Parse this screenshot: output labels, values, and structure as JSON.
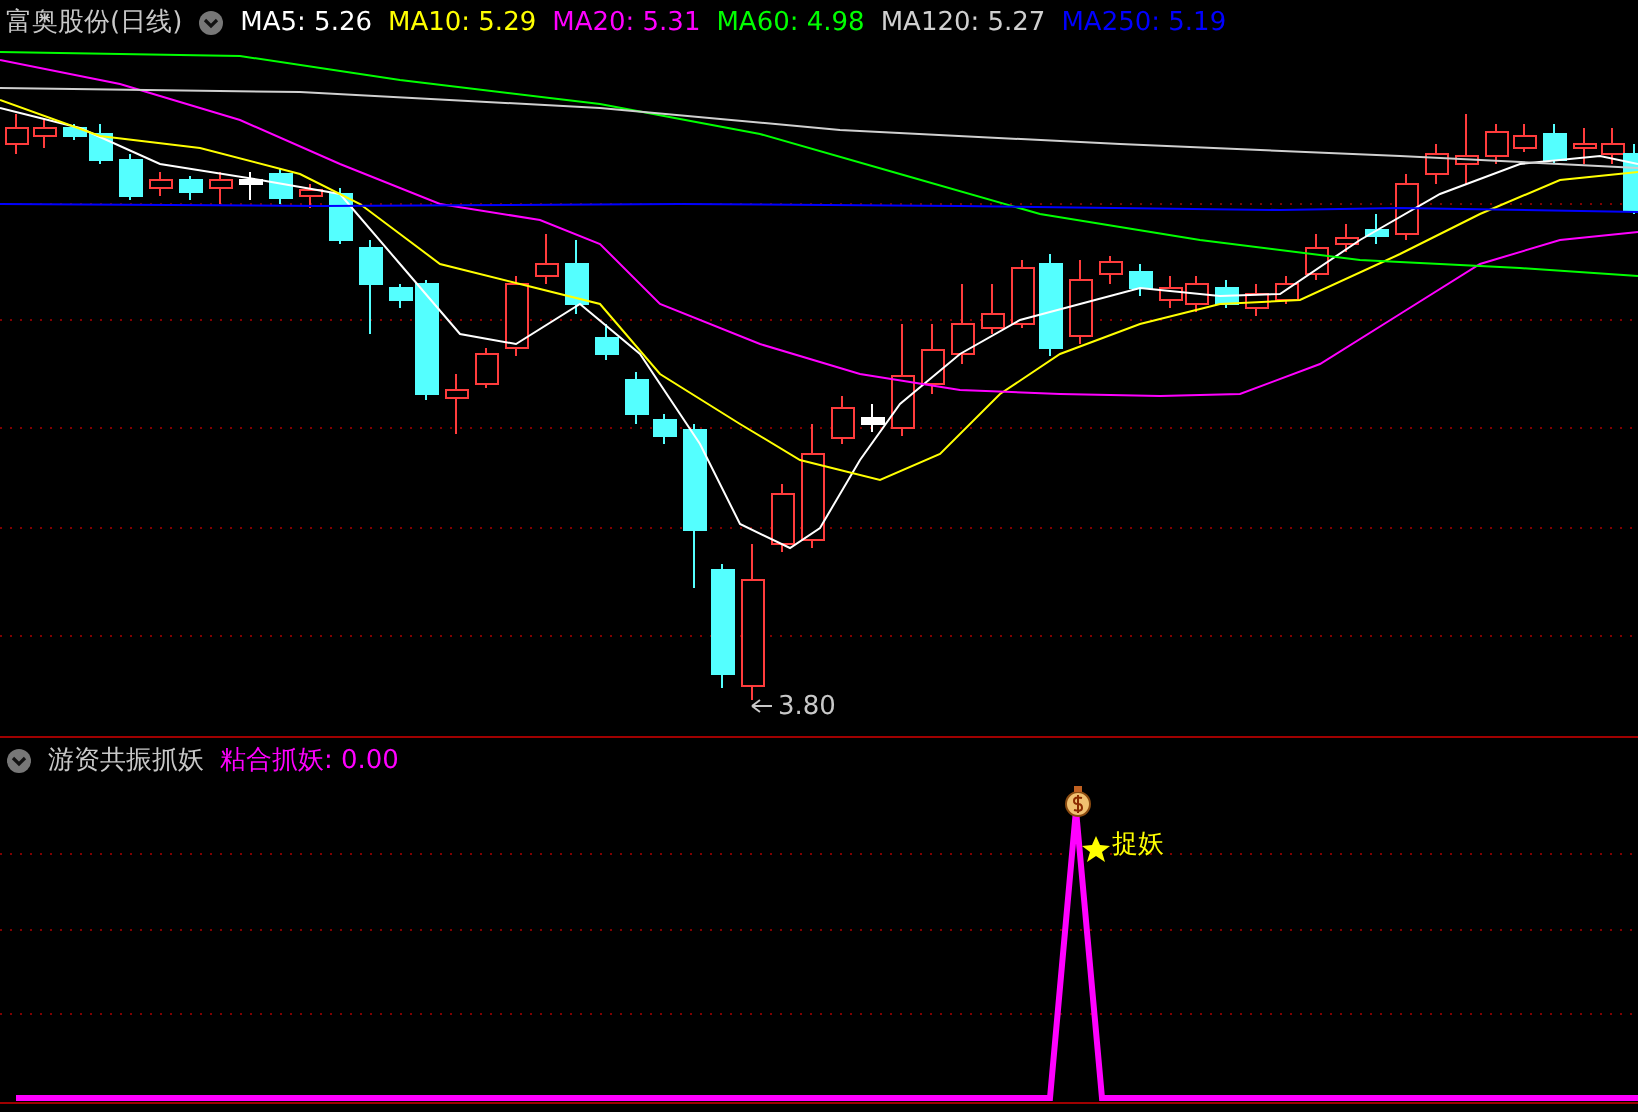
{
  "main_panel": {
    "title": "富奥股份(日线)",
    "indicators": [
      {
        "label": "MA5: 5.26",
        "color": "#ffffff"
      },
      {
        "label": "MA10: 5.29",
        "color": "#ffff00"
      },
      {
        "label": "MA20: 5.31",
        "color": "#ff00ff"
      },
      {
        "label": "MA60: 4.98",
        "color": "#00ff00"
      },
      {
        "label": "MA120: 5.27",
        "color": "#d0d0d0"
      },
      {
        "label": "MA250: 5.19",
        "color": "#0000ff"
      }
    ],
    "low_label": "3.80"
  },
  "indicator_panel": {
    "title": "游资共振抓妖",
    "indicators": [
      {
        "label": "粘合抓妖: 0.00",
        "color": "#ff00ff"
      }
    ],
    "signal_label": "捉妖"
  }
}
